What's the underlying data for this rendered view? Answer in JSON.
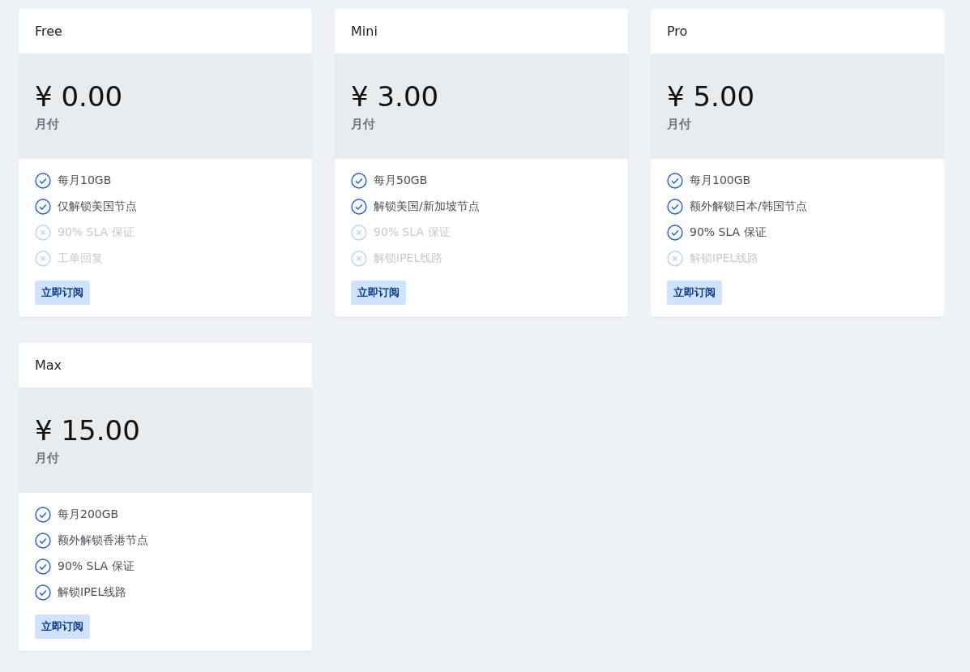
{
  "plans": [
    {
      "name": "Free",
      "price": "¥ 0.00",
      "period": "月付",
      "features": [
        {
          "text": "每月10GB",
          "included": true
        },
        {
          "text": "仅解锁美国节点",
          "included": true
        },
        {
          "text": "90% SLA 保证",
          "included": false
        },
        {
          "text": "工单回复",
          "included": false
        }
      ],
      "button": "立即订阅"
    },
    {
      "name": "Mini",
      "price": "¥ 3.00",
      "period": "月付",
      "features": [
        {
          "text": "每月50GB",
          "included": true
        },
        {
          "text": "解锁美国/新加坡节点",
          "included": true
        },
        {
          "text": "90% SLA 保证",
          "included": false
        },
        {
          "text": "解锁IPEL线路",
          "included": false
        }
      ],
      "button": "立即订阅"
    },
    {
      "name": "Pro",
      "price": "¥ 5.00",
      "period": "月付",
      "features": [
        {
          "text": "每月100GB",
          "included": true
        },
        {
          "text": "额外解锁日本/韩国节点",
          "included": true
        },
        {
          "text": "90% SLA 保证",
          "included": true
        },
        {
          "text": "解锁IPEL线路",
          "included": false
        }
      ],
      "button": "立即订阅"
    },
    {
      "name": "Max",
      "price": "¥ 15.00",
      "period": "月付",
      "features": [
        {
          "text": "每月200GB",
          "included": true
        },
        {
          "text": "额外解锁香港节点",
          "included": true
        },
        {
          "text": "90% SLA 保证",
          "included": true
        },
        {
          "text": "解锁IPEL线路",
          "included": true
        }
      ],
      "button": "立即订阅"
    }
  ]
}
